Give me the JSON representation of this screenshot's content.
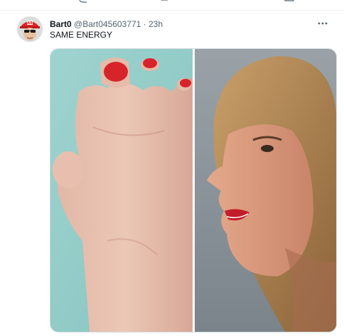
{
  "tweet": {
    "display_name": "Bart0",
    "handle": "@Bart045603771",
    "separator": "·",
    "time": "23h",
    "text": "SAME ENERGY",
    "more_label": "···"
  },
  "avatar": {
    "cap_text": "AB",
    "cap_color": "#e02424"
  },
  "media": {
    "left_panel": "photo-foot",
    "right_panel": "photo-profile-face"
  },
  "colors": {
    "name": "#0f1419",
    "secondary": "#536471",
    "border": "#cfd9de"
  }
}
